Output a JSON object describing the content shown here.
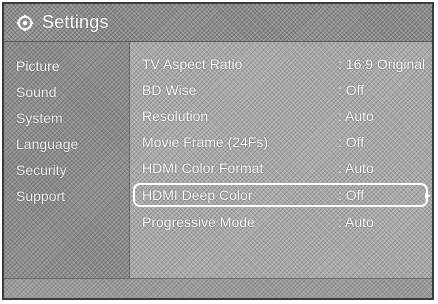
{
  "header": {
    "title": "Settings",
    "icon": "gear-icon"
  },
  "sidebar": {
    "items": [
      {
        "label": "Picture",
        "active": true
      },
      {
        "label": "Sound",
        "active": false
      },
      {
        "label": "System",
        "active": false
      },
      {
        "label": "Language",
        "active": false
      },
      {
        "label": "Security",
        "active": false
      },
      {
        "label": "Support",
        "active": false
      }
    ]
  },
  "main": {
    "rows": [
      {
        "label": "TV Aspect Ratio",
        "value": ": 16:9 Original"
      },
      {
        "label": "BD Wise",
        "value": ": Off"
      },
      {
        "label": "Resolution",
        "value": ": Auto"
      },
      {
        "label": "Movie Frame (24Fs)",
        "value": ": Off"
      },
      {
        "label": "HDMI Color Format",
        "value": ": Auto"
      },
      {
        "label": "HDMI Deep Color",
        "value": ": Off",
        "selected": true,
        "indicator_icon": "chevron-right-icon"
      },
      {
        "label": "Progressive Mode",
        "value": ": Auto"
      }
    ]
  },
  "colors": {
    "text": "#ffffff",
    "panel": "#8d8d8d",
    "background": "#a9a9a9",
    "selection_border": "#ffffff"
  }
}
